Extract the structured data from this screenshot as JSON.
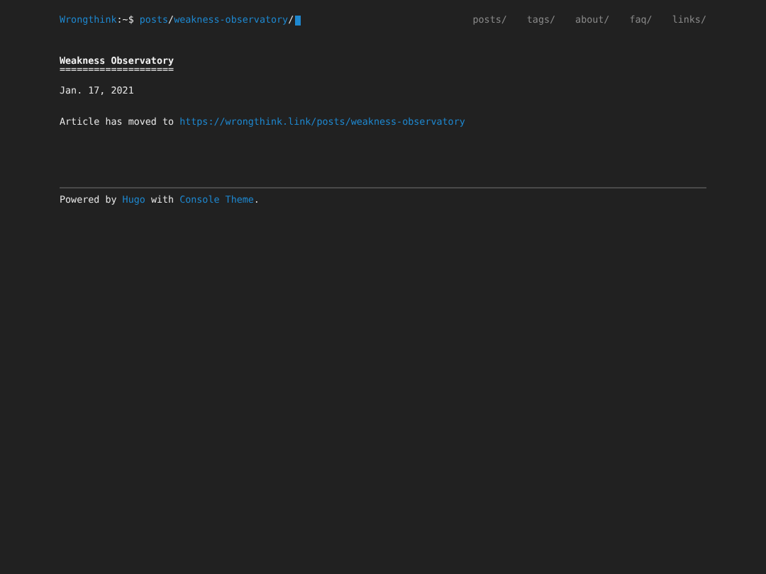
{
  "prompt": {
    "segments": [
      {
        "kind": "link",
        "text": "Wrongthink"
      },
      {
        "kind": "text",
        "text": ":~$"
      },
      {
        "kind": "link",
        "text": "posts"
      },
      {
        "kind": "text",
        "text": "/"
      },
      {
        "kind": "link",
        "text": "weakness-observatory"
      },
      {
        "kind": "text",
        "text": "/"
      }
    ],
    "cursor": true
  },
  "nav": [
    "posts/",
    "tags/",
    "about/",
    "faq/",
    "links/"
  ],
  "post": {
    "title": "Weakness Observatory",
    "underline": "====================",
    "date": "Jan. 17, 2021",
    "body": {
      "text": "Article has moved to",
      "link": "https://wrongthink.link/posts/weakness-observatory"
    }
  },
  "footer": {
    "parts": [
      {
        "kind": "text",
        "text": "Powered by"
      },
      {
        "kind": "link",
        "text": "Hugo"
      },
      {
        "kind": "text",
        "text": "with"
      },
      {
        "kind": "link",
        "text": "Console Theme"
      },
      {
        "kind": "text",
        "text": "."
      }
    ]
  }
}
